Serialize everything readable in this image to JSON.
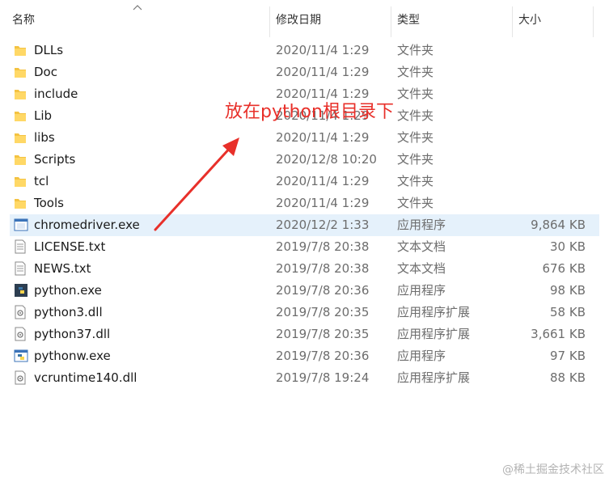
{
  "header": {
    "name_label": "名称",
    "date_label": "修改日期",
    "type_label": "类型",
    "size_label": "大小"
  },
  "files": [
    {
      "name": "DLLs",
      "date": "2020/11/4 1:29",
      "type": "文件夹",
      "size": "",
      "icon": "folder-icon"
    },
    {
      "name": "Doc",
      "date": "2020/11/4 1:29",
      "type": "文件夹",
      "size": "",
      "icon": "folder-icon"
    },
    {
      "name": "include",
      "date": "2020/11/4 1:29",
      "type": "文件夹",
      "size": "",
      "icon": "folder-icon"
    },
    {
      "name": "Lib",
      "date": "2020/11/4 1:29",
      "type": "文件夹",
      "size": "",
      "icon": "folder-icon"
    },
    {
      "name": "libs",
      "date": "2020/11/4 1:29",
      "type": "文件夹",
      "size": "",
      "icon": "folder-icon"
    },
    {
      "name": "Scripts",
      "date": "2020/12/8 10:20",
      "type": "文件夹",
      "size": "",
      "icon": "folder-icon"
    },
    {
      "name": "tcl",
      "date": "2020/11/4 1:29",
      "type": "文件夹",
      "size": "",
      "icon": "folder-icon"
    },
    {
      "name": "Tools",
      "date": "2020/11/4 1:29",
      "type": "文件夹",
      "size": "",
      "icon": "folder-icon"
    },
    {
      "name": "chromedriver.exe",
      "date": "2020/12/2 1:33",
      "type": "应用程序",
      "size": "9,864 KB",
      "icon": "application-icon",
      "selected": true
    },
    {
      "name": "LICENSE.txt",
      "date": "2019/7/8 20:38",
      "type": "文本文档",
      "size": "30 KB",
      "icon": "text-document-icon"
    },
    {
      "name": "NEWS.txt",
      "date": "2019/7/8 20:38",
      "type": "文本文档",
      "size": "676 KB",
      "icon": "text-document-icon"
    },
    {
      "name": "python.exe",
      "date": "2019/7/8 20:36",
      "type": "应用程序",
      "size": "98 KB",
      "icon": "python-exe-icon"
    },
    {
      "name": "python3.dll",
      "date": "2019/7/8 20:35",
      "type": "应用程序扩展",
      "size": "58 KB",
      "icon": "dll-icon"
    },
    {
      "name": "python37.dll",
      "date": "2019/7/8 20:35",
      "type": "应用程序扩展",
      "size": "3,661 KB",
      "icon": "dll-icon"
    },
    {
      "name": "pythonw.exe",
      "date": "2019/7/8 20:36",
      "type": "应用程序",
      "size": "97 KB",
      "icon": "pythonw-exe-icon"
    },
    {
      "name": "vcruntime140.dll",
      "date": "2019/7/8 19:24",
      "type": "应用程序扩展",
      "size": "88 KB",
      "icon": "dll-icon"
    }
  ],
  "annotation": {
    "text": "放在python根目录下",
    "color": "#e8302a"
  },
  "watermark": "@稀土掘金技术社区",
  "colors": {
    "selection": "#e5f1fb",
    "folder": "#f4c342"
  }
}
